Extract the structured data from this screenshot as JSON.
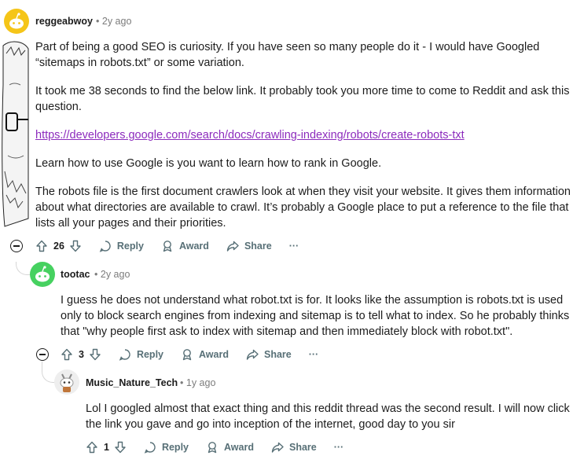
{
  "comments": [
    {
      "username": "reggeabwoy",
      "time": "2y ago",
      "avatar_color": "#f5c518",
      "paragraphs": [
        "Part of being a good SEO is curiosity. If you have seen so many people do it - I would have Googled “sitemaps in robots.txt” or some variation.",
        "It took me 38 seconds to find the below link. It probably took you more time to come to Reddit and ask this question."
      ],
      "link": "https://developers.google.com/search/docs/crawling-indexing/robots/create-robots-txt",
      "paragraphs_after": [
        "Learn how to use Google is you want to learn how to rank in Google.",
        "The robots file is the first document crawlers look at when they visit your website. It gives them information about what directories are available to crawl. It’s probably a Google place to put a reference to the file that lists all your pages and their priorities."
      ],
      "votes": "26",
      "reply_label": "Reply",
      "award_label": "Award",
      "share_label": "Share",
      "more_label": "···"
    },
    {
      "username": "tootac",
      "time": "2y ago",
      "avatar_color": "#46d160",
      "text": "I guess he does not understand what robot.txt is for. It looks like the assumption is robots.txt is used only to block search engines from indexing and sitemap is to tell what to index. So he probably thinks that \"why people first ask to index with sitemap and then immediately block with robot.txt\".",
      "votes": "3",
      "reply_label": "Reply",
      "award_label": "Award",
      "share_label": "Share",
      "more_label": "···"
    },
    {
      "username": "Music_Nature_Tech",
      "time": "1y ago",
      "avatar_color": "#eeeeee",
      "text": "Lol I googled almost that exact thing and this reddit thread was the second result. I will now click the link you gave and go into inception of the internet, good day to you sir",
      "votes": "1",
      "reply_label": "Reply",
      "award_label": "Award",
      "share_label": "Share",
      "more_label": "···"
    }
  ],
  "separator": "•",
  "colors": {
    "link": "#8c2bbd",
    "meta": "#7c7c7c",
    "action": "#576f76"
  }
}
